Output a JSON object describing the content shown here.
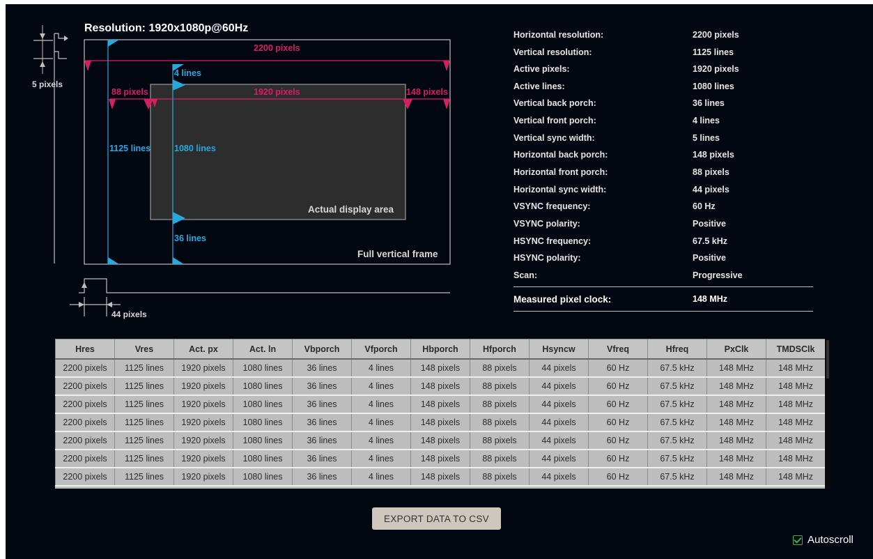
{
  "diagram": {
    "title": "Resolution: 1920x1080p@60Hz",
    "total_width_label": "2200 pixels",
    "active_width_label": "1920 pixels",
    "front_porch_h_label": "88 pixels",
    "back_porch_h_label": "148 pixels",
    "total_height_label": "1125 lines",
    "active_height_label": "1080 lines",
    "front_porch_v_label": "4 lines",
    "back_porch_v_label": "36 lines",
    "vsync_width_label": "5 pixels",
    "hsync_width_label": "44 pixels",
    "active_area_label": "Actual display area",
    "full_frame_label": "Full vertical frame",
    "colors": {
      "horizontal": "#d61f63",
      "vertical": "#29a8dc"
    }
  },
  "parameters": [
    {
      "name": "Horizontal resolution:",
      "value": "2200 pixels"
    },
    {
      "name": "Vertical resolution:",
      "value": "1125 lines"
    },
    {
      "name": "Active pixels:",
      "value": "1920 pixels"
    },
    {
      "name": "Active lines:",
      "value": "1080 lines"
    },
    {
      "name": "Vertical back porch:",
      "value": "36 lines"
    },
    {
      "name": "Vertical front porch:",
      "value": "4 lines"
    },
    {
      "name": "Vertical sync width:",
      "value": "5 lines"
    },
    {
      "name": "Horizontal back porch:",
      "value": "148 pixels"
    },
    {
      "name": "Horizontal front porch:",
      "value": "88 pixels"
    },
    {
      "name": "Horizontal sync width:",
      "value": "44 pixels"
    },
    {
      "name": "VSYNC frequency:",
      "value": "60 Hz"
    },
    {
      "name": "VSYNC polarity:",
      "value": "Positive"
    },
    {
      "name": "HSYNC frequency:",
      "value": "67.5 kHz"
    },
    {
      "name": "HSYNC polarity:",
      "value": "Positive"
    },
    {
      "name": "Scan:",
      "value": "Progressive"
    }
  ],
  "pixel_clock": {
    "name": "Measured pixel clock:",
    "value": "148 MHz"
  },
  "table": {
    "headers": [
      "Hres",
      "Vres",
      "Act. px",
      "Act. ln",
      "Vbporch",
      "Vfporch",
      "Hbporch",
      "Hfporch",
      "Hsyncw",
      "Vfreq",
      "Hfreq",
      "PxClk",
      "TMDSClk"
    ],
    "rows": [
      [
        "2200 pixels",
        "1125 lines",
        "1920 pixels",
        "1080 lines",
        "36 lines",
        "4 lines",
        "148 pixels",
        "88 pixels",
        "44 pixels",
        "60 Hz",
        "67.5 kHz",
        "148 MHz",
        "148 MHz"
      ],
      [
        "2200 pixels",
        "1125 lines",
        "1920 pixels",
        "1080 lines",
        "36 lines",
        "4 lines",
        "148 pixels",
        "88 pixels",
        "44 pixels",
        "60 Hz",
        "67.5 kHz",
        "148 MHz",
        "148 MHz"
      ],
      [
        "2200 pixels",
        "1125 lines",
        "1920 pixels",
        "1080 lines",
        "36 lines",
        "4 lines",
        "148 pixels",
        "88 pixels",
        "44 pixels",
        "60 Hz",
        "67.5 kHz",
        "148 MHz",
        "148 MHz"
      ],
      [
        "2200 pixels",
        "1125 lines",
        "1920 pixels",
        "1080 lines",
        "36 lines",
        "4 lines",
        "148 pixels",
        "88 pixels",
        "44 pixels",
        "60 Hz",
        "67.5 kHz",
        "148 MHz",
        "148 MHz"
      ],
      [
        "2200 pixels",
        "1125 lines",
        "1920 pixels",
        "1080 lines",
        "36 lines",
        "4 lines",
        "148 pixels",
        "88 pixels",
        "44 pixels",
        "60 Hz",
        "67.5 kHz",
        "148 MHz",
        "148 MHz"
      ],
      [
        "2200 pixels",
        "1125 lines",
        "1920 pixels",
        "1080 lines",
        "36 lines",
        "4 lines",
        "148 pixels",
        "88 pixels",
        "44 pixels",
        "60 Hz",
        "67.5 kHz",
        "148 MHz",
        "148 MHz"
      ],
      [
        "2200 pixels",
        "1125 lines",
        "1920 pixels",
        "1080 lines",
        "36 lines",
        "4 lines",
        "148 pixels",
        "88 pixels",
        "44 pixels",
        "60 Hz",
        "67.5 kHz",
        "148 MHz",
        "148 MHz"
      ]
    ]
  },
  "export_button": {
    "label": "EXPORT DATA TO CSV"
  },
  "autoscroll": {
    "label": "Autoscroll",
    "checked": true
  }
}
